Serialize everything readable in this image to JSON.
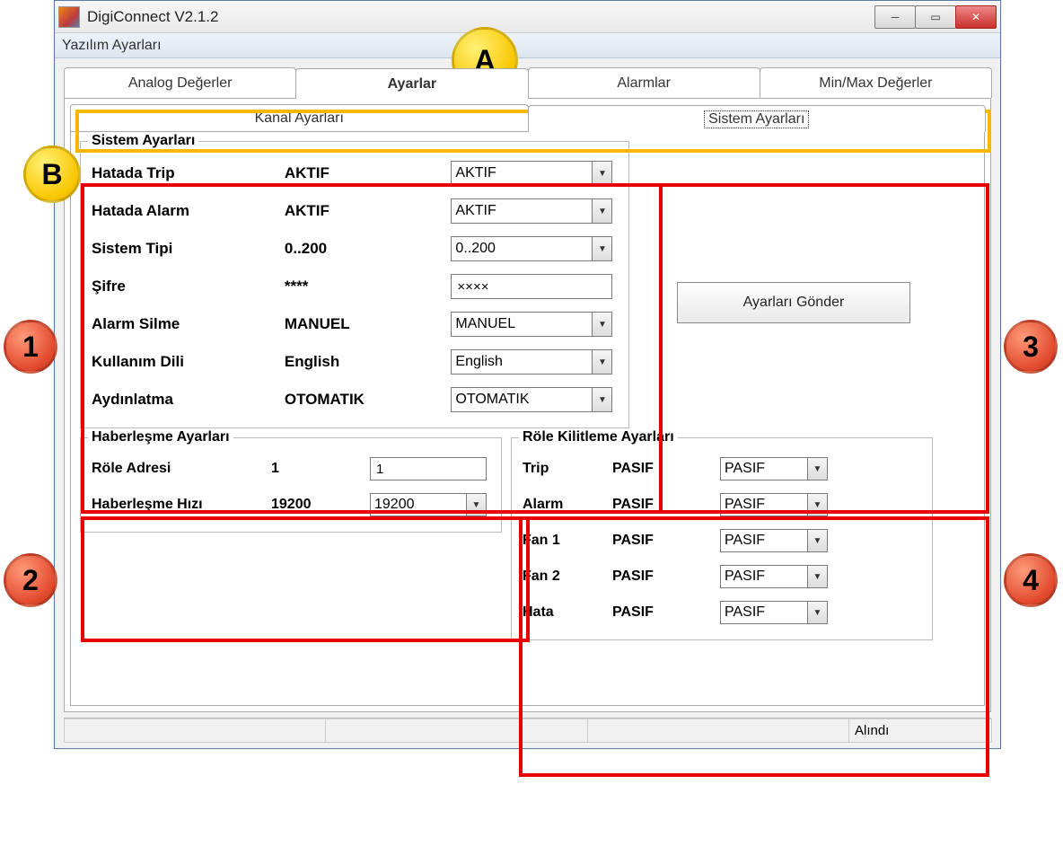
{
  "window": {
    "title": "DigiConnect V2.1.2"
  },
  "menubar": {
    "label": "Yazılım Ayarları"
  },
  "tabs": {
    "items": [
      {
        "label": "Analog Değerler"
      },
      {
        "label": "Ayarlar"
      },
      {
        "label": "Alarmlar"
      },
      {
        "label": "Min/Max Değerler"
      }
    ],
    "active_index": 1
  },
  "subtabs": {
    "items": [
      {
        "label": "Kanal Ayarları"
      },
      {
        "label": "Sistem Ayarları"
      }
    ],
    "active_index": 1
  },
  "system_settings": {
    "legend": "Sistem Ayarları",
    "rows": [
      {
        "label": "Hatada Trip",
        "value": "AKTIF",
        "select": "AKTIF"
      },
      {
        "label": "Hatada Alarm",
        "value": "AKTIF",
        "select": "AKTIF"
      },
      {
        "label": "Sistem Tipi",
        "value": "0..200",
        "select": "0..200"
      },
      {
        "label": "Şifre",
        "value": "****",
        "input": "××××"
      },
      {
        "label": "Alarm Silme",
        "value": "MANUEL",
        "select": "MANUEL"
      },
      {
        "label": "Kullanım Dili",
        "value": "English",
        "select": "English"
      },
      {
        "label": "Aydınlatma",
        "value": "OTOMATIK",
        "select": "OTOMATIK"
      }
    ]
  },
  "send_button": "Ayarları Gönder",
  "comm_settings": {
    "legend": "Haberleşme Ayarları",
    "rows": [
      {
        "label": "Röle Adresi",
        "value": "1",
        "input": "1"
      },
      {
        "label": "Haberleşme Hızı",
        "value": "19200",
        "select": "19200"
      }
    ]
  },
  "relay_lock_settings": {
    "legend": "Röle Kilitleme Ayarları",
    "rows": [
      {
        "label": "Trip",
        "value": "PASIF",
        "select": "PASIF"
      },
      {
        "label": "Alarm",
        "value": "PASIF",
        "select": "PASIF"
      },
      {
        "label": "Fan 1",
        "value": "PASIF",
        "select": "PASIF"
      },
      {
        "label": "Fan 2",
        "value": "PASIF",
        "select": "PASIF"
      },
      {
        "label": "Hata",
        "value": "PASIF",
        "select": "PASIF"
      }
    ]
  },
  "statusbar": {
    "cells": [
      "",
      "",
      "",
      "Alındı"
    ]
  },
  "annotations": {
    "A": "A",
    "B": "B",
    "n1": "1",
    "n2": "2",
    "n3": "3",
    "n4": "4"
  }
}
